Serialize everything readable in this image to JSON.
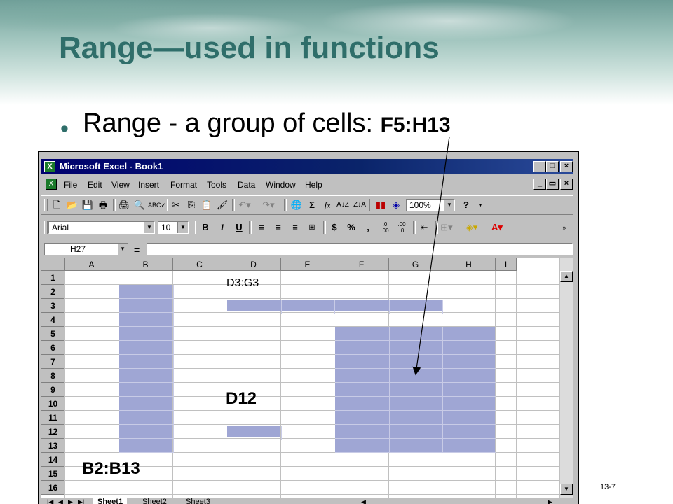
{
  "slide": {
    "title": "Range—used in functions",
    "bullet_text": "Range - a group of cells: ",
    "bullet_emphasis": "F5:H13",
    "page_number": "13-7",
    "callouts": {
      "d3g3": "D3:G3",
      "d12": "D12",
      "b2b13": "B2:B13"
    }
  },
  "excel": {
    "window_title": "Microsoft Excel - Book1",
    "menu": [
      "File",
      "Edit",
      "View",
      "Insert",
      "Format",
      "Tools",
      "Data",
      "Window",
      "Help"
    ],
    "zoom": "100%",
    "font_name": "Arial",
    "font_size": "10",
    "name_box": "H27",
    "formula_eq": "=",
    "columns": [
      "A",
      "B",
      "C",
      "D",
      "E",
      "F",
      "G",
      "H",
      "I"
    ],
    "rows": [
      "1",
      "2",
      "3",
      "4",
      "5",
      "6",
      "7",
      "8",
      "9",
      "10",
      "11",
      "12",
      "13",
      "14",
      "15",
      "16"
    ],
    "sheets": [
      "Sheet1",
      "Sheet2",
      "Sheet3"
    ],
    "icons": {
      "standard": [
        "new-icon",
        "open-icon",
        "save-icon",
        "print-preview-icon",
        "print-icon",
        "preview-icon",
        "spelling-icon",
        "cut-icon",
        "copy-icon",
        "paste-icon",
        "format-painter-icon",
        "undo-icon",
        "redo-icon",
        "hyperlink-icon",
        "autosum-icon",
        "function-icon",
        "sort-ascending-icon",
        "sort-descending-icon",
        "chart-wizard-icon",
        "drawing-icon",
        "help-icon"
      ],
      "formatting": [
        "bold-icon",
        "italic-icon",
        "underline-icon",
        "align-left-icon",
        "center-icon",
        "align-right-icon",
        "merge-center-icon",
        "currency-icon",
        "percent-icon",
        "comma-icon",
        "increase-decimal-icon",
        "decrease-decimal-icon",
        "indent-icon",
        "borders-icon",
        "fill-color-icon",
        "font-color-icon"
      ]
    },
    "highlight_color": "#9fa6d4",
    "title_color": "#2f6e6a"
  }
}
